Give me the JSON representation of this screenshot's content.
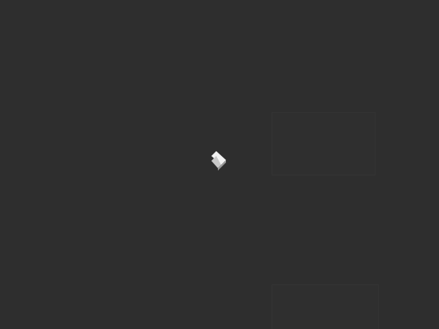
{
  "app": {
    "state": "loading",
    "logo_icon": "cube-logo-icon",
    "background_color": "#2e2e2e",
    "logo_light_color": "#f2f2f2",
    "logo_mid_color": "#c9c9c9",
    "logo_dark_color": "#9a9a9a"
  }
}
